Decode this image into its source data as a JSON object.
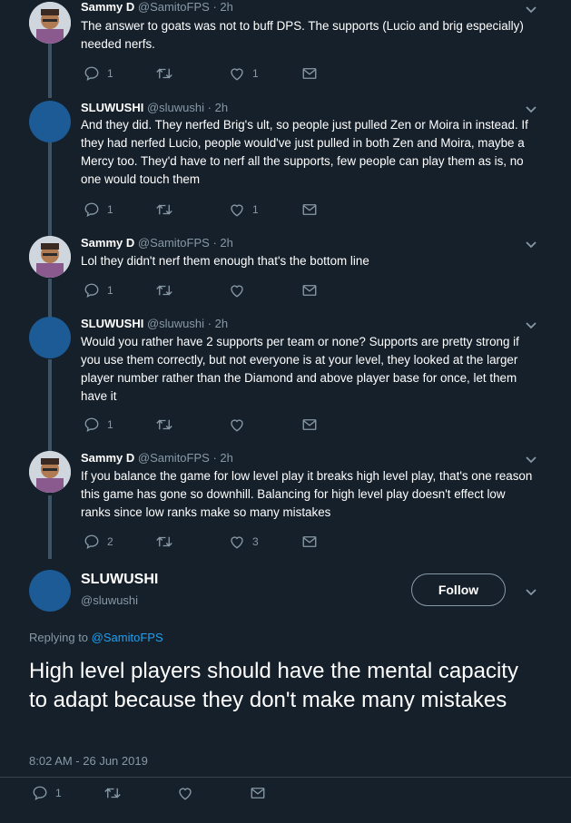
{
  "tweets": [
    {
      "name": "Sammy D",
      "handle": "@SamitoFPS",
      "sep": "·",
      "time": "2h",
      "text": "The answer to goats was not to buff DPS. The supports (Lucio and brig especially) needed nerfs.",
      "reply_count": "1",
      "retweet_count": "",
      "like_count": "1"
    },
    {
      "name": "SLUWUSHI",
      "handle": "@sluwushi",
      "sep": "·",
      "time": "2h",
      "text": "And they did. They nerfed Brig's ult, so people just pulled Zen or Moira in instead. If they had nerfed Lucio, people would've just pulled in both Zen and Moira, maybe a Mercy too. They'd have to nerf all the supports, few people can play them as is, no one would touch them",
      "reply_count": "1",
      "retweet_count": "",
      "like_count": "1"
    },
    {
      "name": "Sammy D",
      "handle": "@SamitoFPS",
      "sep": "·",
      "time": "2h",
      "text": "Lol they didn't nerf them enough that's the bottom line",
      "reply_count": "1",
      "retweet_count": "",
      "like_count": ""
    },
    {
      "name": "SLUWUSHI",
      "handle": "@sluwushi",
      "sep": "·",
      "time": "2h",
      "text": "Would you rather have 2 supports per team or none? Supports are pretty strong if you use them correctly, but not everyone is at your level, they looked at the larger player number rather than the Diamond and above player base for once, let them have it",
      "reply_count": "1",
      "retweet_count": "",
      "like_count": ""
    },
    {
      "name": "Sammy D",
      "handle": "@SamitoFPS",
      "sep": "·",
      "time": "2h",
      "text": "If you balance the game for low level play it breaks high level play, that's one reason this game has gone so downhill. Balancing for high level play doesn't effect low ranks since low ranks make so many mistakes",
      "reply_count": "2",
      "retweet_count": "",
      "like_count": "3"
    }
  ],
  "main": {
    "name": "SLUWUSHI",
    "handle": "@sluwushi",
    "follow_label": "Follow",
    "replying_prefix": "Replying to",
    "replying_handle": "@SamitoFPS",
    "text": "High level players should have the mental capacity to adapt because they don't make many mistakes",
    "timestamp": "8:02 AM - 26 Jun 2019",
    "reply_count": "1",
    "retweet_count": "",
    "like_count": ""
  },
  "colors": {
    "background": "#15202b",
    "secondary_text": "#8899a6",
    "thread_line": "#3d5466",
    "link": "#1da1f2",
    "avatar_blue": "#1c5b96"
  },
  "icons": {
    "reply": "speech-bubble-icon",
    "retweet": "retweet-arrows-icon",
    "like": "heart-icon",
    "dm": "envelope-icon",
    "more": "chevron-down-icon"
  }
}
